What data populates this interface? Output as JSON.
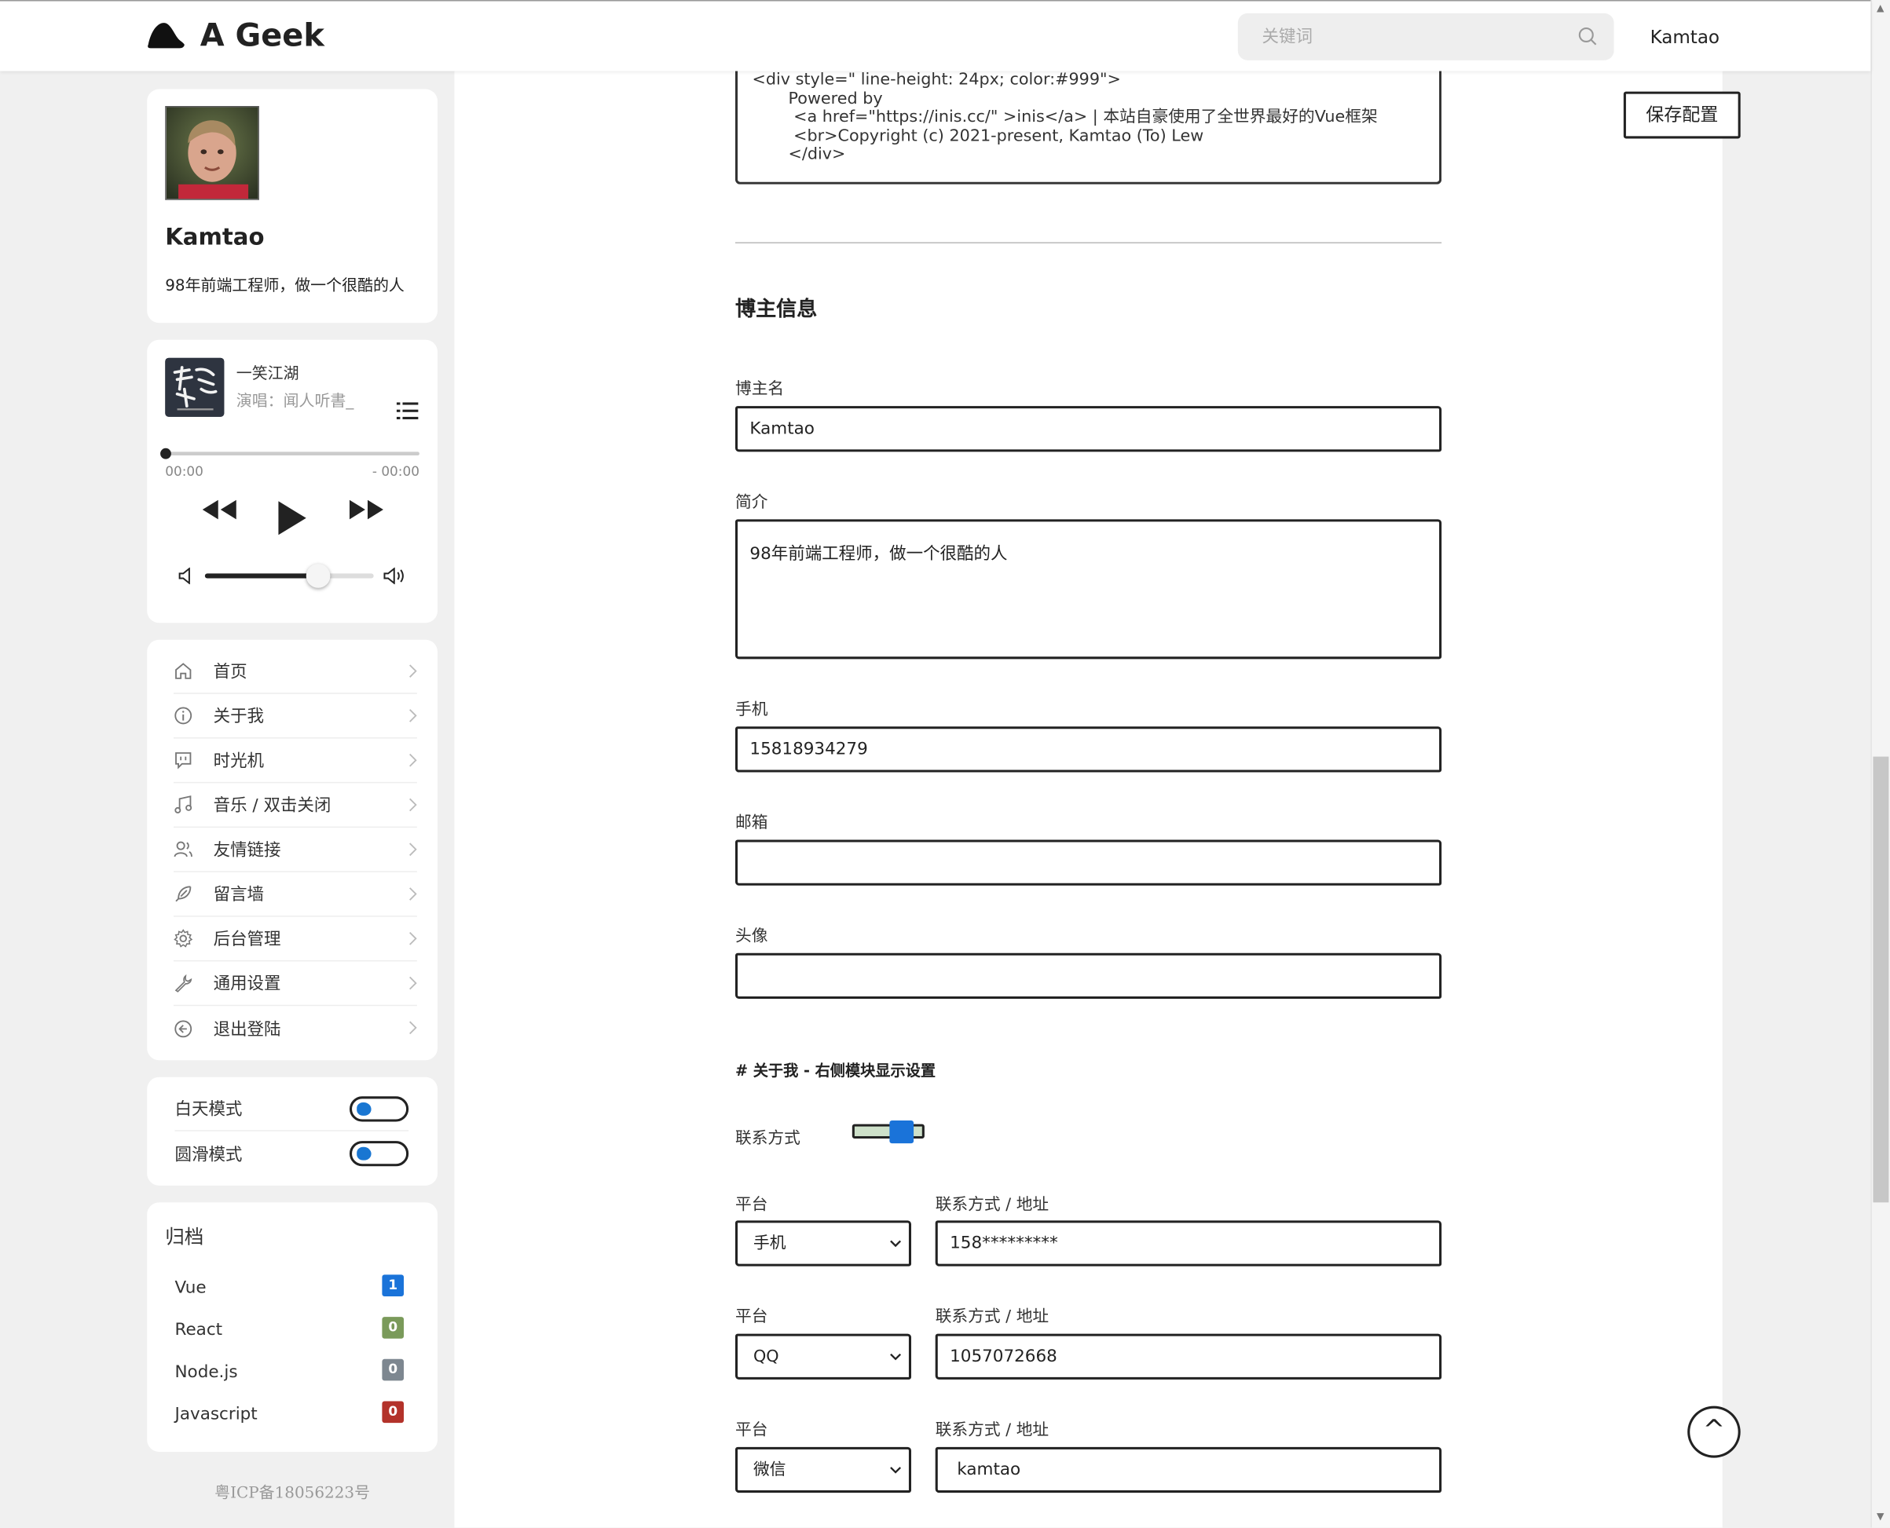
{
  "header": {
    "site_name": "A Geek",
    "search_placeholder": "关键词",
    "user": "Kamtao"
  },
  "profile": {
    "name": "Kamtao",
    "bio": "98年前端工程师，做一个很酷的人"
  },
  "player": {
    "title": "一笑江湖",
    "artist": "演唱：闻人听書_",
    "time_current": "00:00",
    "time_remaining": "- 00:00",
    "volume": 0.67,
    "progress": 0
  },
  "nav": {
    "items": [
      {
        "label": "首页",
        "icon": "home-icon"
      },
      {
        "label": "关于我",
        "icon": "info-icon"
      },
      {
        "label": "时光机",
        "icon": "message-icon"
      },
      {
        "label": "音乐 / 双击关闭",
        "icon": "music-icon"
      },
      {
        "label": "友情链接",
        "icon": "users-icon"
      },
      {
        "label": "留言墙",
        "icon": "feather-icon"
      },
      {
        "label": "后台管理",
        "icon": "gear-icon"
      },
      {
        "label": "通用设置",
        "icon": "wrench-icon"
      },
      {
        "label": "退出登陆",
        "icon": "logout-icon"
      }
    ]
  },
  "modes": {
    "day": "白天模式",
    "smooth": "圆滑模式"
  },
  "archive": {
    "title": "归档",
    "items": [
      {
        "label": "Vue",
        "count": "1",
        "color": "#1a73d9"
      },
      {
        "label": "React",
        "count": "0",
        "color": "#7a9a5a"
      },
      {
        "label": "Node.js",
        "count": "0",
        "color": "#7d8790"
      },
      {
        "label": "Javascript",
        "count": "0",
        "color": "#b3322a"
      }
    ]
  },
  "footer": {
    "icp": "粤ICP备18056223号"
  },
  "form": {
    "footer_code": "<div style=\" line-height: 24px; color:#999\">\n       Powered by\n        <a href=\"https://inis.cc/\" >inis</a> | 本站自豪使用了全世界最好的Vue框架\n        <br>Copyright (c) 2021-present, Kamtao (To) Lew\n       </div>",
    "section_title": "博主信息",
    "blogger_name_label": "博主名",
    "blogger_name_value": "Kamtao",
    "intro_label": "简介",
    "intro_value": "98年前端工程师，做一个很酷的人",
    "phone_label": "手机",
    "phone_value": "15818934279",
    "email_label": "邮箱",
    "email_value": "",
    "avatar_label": "头像",
    "avatar_value": "",
    "about_title": "# 关于我 - 右侧模块显示设置",
    "contact_label": "联系方式",
    "platform_label": "平台",
    "address_label": "联系方式 / 地址",
    "contacts": [
      {
        "platform": "手机",
        "value": "158*********"
      },
      {
        "platform": "QQ",
        "value": "1057072668"
      },
      {
        "platform": "微信",
        "value": "kamtao"
      }
    ]
  },
  "actions": {
    "save": "保存配置",
    "top": "^"
  }
}
